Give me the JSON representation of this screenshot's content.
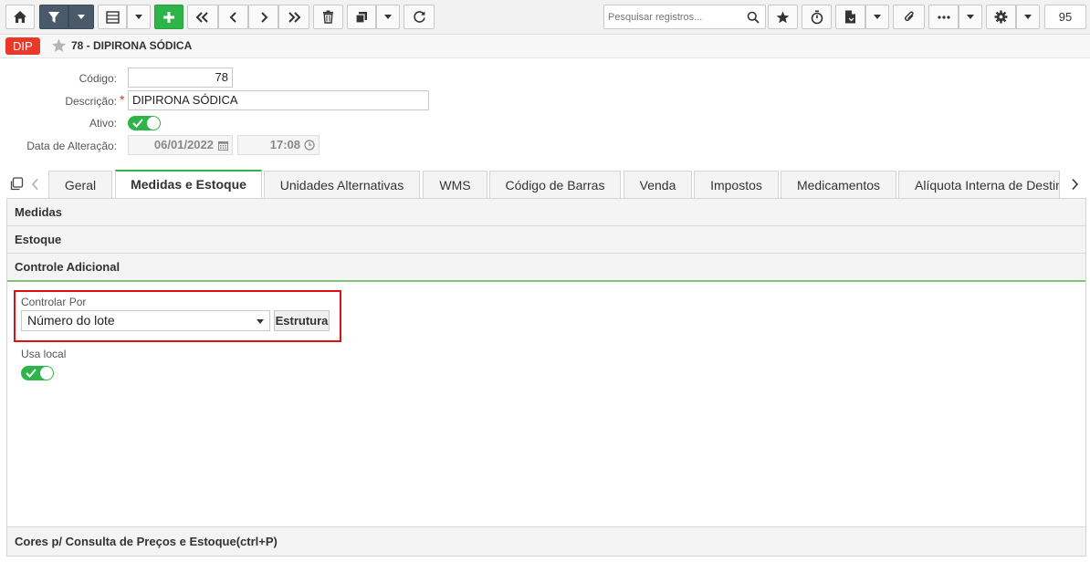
{
  "toolbar": {
    "search_placeholder": "Pesquisar registros...",
    "page_number": "95",
    "icons": [
      "home-icon",
      "filter-icon",
      "grid-icon",
      "add-icon",
      "first-icon",
      "prev-icon",
      "next-icon",
      "last-icon",
      "trash-icon",
      "copy-icon",
      "refresh-icon",
      "search-icon",
      "star-icon",
      "stopwatch-icon",
      "report-icon",
      "paperclip-icon",
      "more-icon",
      "gear-icon"
    ]
  },
  "record": {
    "badge": "DIP",
    "title": "78 - DIPIRONA SÓDICA"
  },
  "form": {
    "codigo_label": "Código:",
    "codigo_value": "78",
    "descricao_label": "Descrição:",
    "descricao_required": "*",
    "descricao_value": "DIPIRONA SÓDICA",
    "ativo_label": "Ativo:",
    "ativo_on": true,
    "data_label": "Data de Alteração:",
    "data_value": "06/01/2022",
    "hora_value": "17:08"
  },
  "tabs": [
    {
      "label": "Geral"
    },
    {
      "label": "Medidas e Estoque",
      "active": true
    },
    {
      "label": "Unidades Alternativas"
    },
    {
      "label": "WMS"
    },
    {
      "label": "Código de Barras"
    },
    {
      "label": "Venda"
    },
    {
      "label": "Impostos"
    },
    {
      "label": "Medicamentos"
    },
    {
      "label": "Alíquota Interna de Destin"
    }
  ],
  "sections": {
    "medidas": "Medidas",
    "estoque": "Estoque",
    "controle": "Controle Adicional",
    "cores": "Cores p/ Consulta de Preços e Estoque(ctrl+P)"
  },
  "controle": {
    "controlar_label": "Controlar Por",
    "controlar_value": "Número do lote",
    "estrutura_button": "Estrutura",
    "usa_local_label": "Usa local",
    "usa_local_on": true
  },
  "colors": {
    "accent_green": "#2db54a",
    "badge_red": "#e8392a",
    "highlight_red": "#e01010",
    "toolbar_dark": "#4a5a6a"
  }
}
